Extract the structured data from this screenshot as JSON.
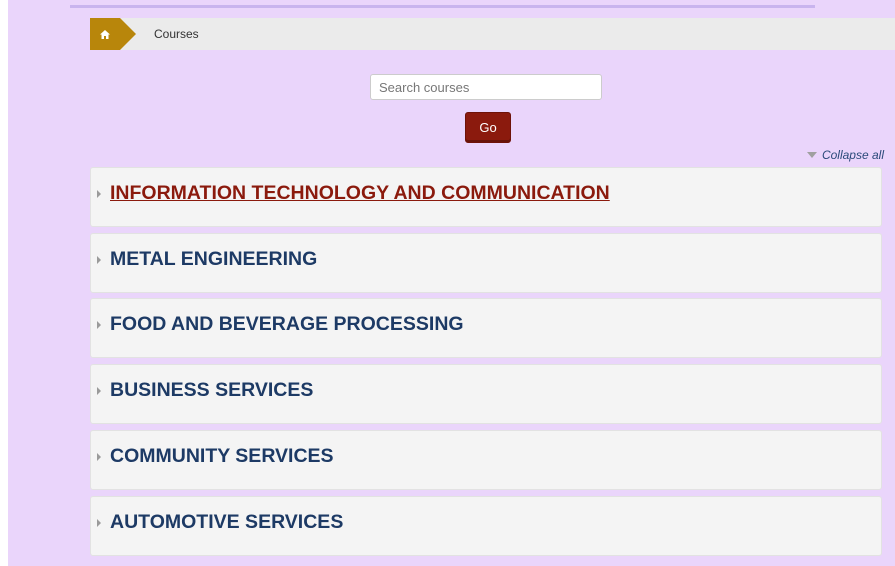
{
  "breadcrumb": {
    "home_icon": "home-icon",
    "current": "Courses"
  },
  "search": {
    "placeholder": "Search courses",
    "value": "",
    "go_label": "Go"
  },
  "collapse_all_label": "Collapse all",
  "categories": [
    {
      "label": "INFORMATION TECHNOLOGY AND COMMUNICATION",
      "hovered": true
    },
    {
      "label": "METAL ENGINEERING"
    },
    {
      "label": "FOOD AND BEVERAGE PROCESSING"
    },
    {
      "label": "BUSINESS SERVICES"
    },
    {
      "label": "COMMUNITY SERVICES"
    },
    {
      "label": "AUTOMOTIVE SERVICES"
    }
  ],
  "colors": {
    "page_background": "#ead5fb",
    "home_crumb": "#b8860b",
    "go_button": "#8b1a0d",
    "category_title": "#1d3a65",
    "category_title_hover": "#8b1a0d"
  }
}
